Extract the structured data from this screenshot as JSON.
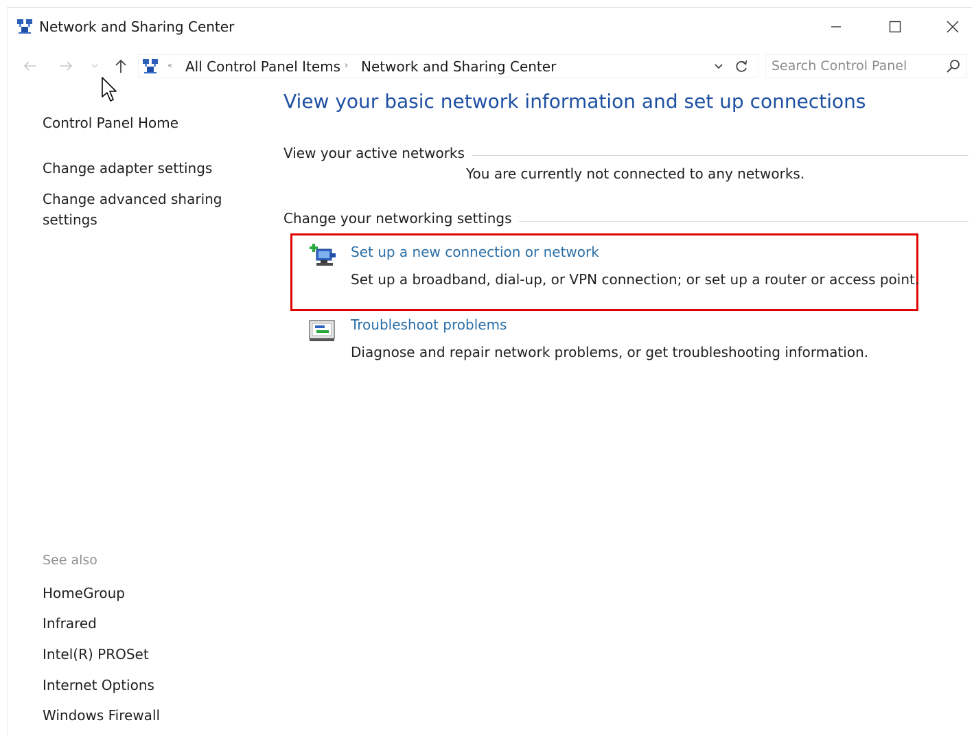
{
  "window": {
    "title": "Network and Sharing Center"
  },
  "address_bar": {
    "crumbs": [
      "All Control Panel Items",
      "Network and Sharing Center"
    ],
    "search_placeholder": "Search Control Panel"
  },
  "left_pane": {
    "home": "Control Panel Home",
    "links": [
      "Change adapter settings",
      "Change advanced sharing settings"
    ],
    "see_also_label": "See also",
    "see_also": [
      "HomeGroup",
      "Infrared",
      "Intel(R) PROSet",
      "Internet Options",
      "Windows Firewall"
    ]
  },
  "main": {
    "heading": "View your basic network information and set up connections",
    "active_networks": {
      "title": "View your active networks",
      "status": "You are currently not connected to any networks."
    },
    "settings": {
      "title": "Change your networking settings",
      "tasks": [
        {
          "label": "Set up a new connection or network",
          "description": "Set up a broadband, dial-up, or VPN connection; or set up a router or access point.",
          "icon": "new-connection-icon"
        },
        {
          "label": "Troubleshoot problems",
          "description": "Diagnose and repair network problems, or get troubleshooting information.",
          "icon": "troubleshoot-icon"
        }
      ]
    }
  },
  "colors": {
    "heading": "#1e50a2",
    "link": "#2a6ea6",
    "highlight": "#e00000"
  }
}
